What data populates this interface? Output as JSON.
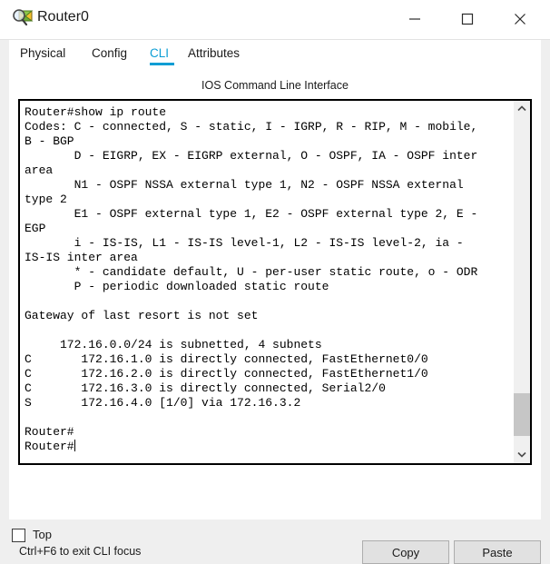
{
  "window": {
    "title": "Router0",
    "icon": "router-inspect-icon",
    "controls": {
      "minimize": "minimize-icon",
      "maximize": "maximize-icon",
      "close": "close-icon"
    }
  },
  "tabs": [
    {
      "label": "Physical",
      "active": false
    },
    {
      "label": "Config",
      "active": false
    },
    {
      "label": "CLI",
      "active": true
    },
    {
      "label": "Attributes",
      "active": false
    }
  ],
  "panel": {
    "heading": "IOS Command Line Interface",
    "terminal_text": "Router#show ip route\nCodes: C - connected, S - static, I - IGRP, R - RIP, M - mobile,\nB - BGP\n       D - EIGRP, EX - EIGRP external, O - OSPF, IA - OSPF inter\narea\n       N1 - OSPF NSSA external type 1, N2 - OSPF NSSA external\ntype 2\n       E1 - OSPF external type 1, E2 - OSPF external type 2, E -\nEGP\n       i - IS-IS, L1 - IS-IS level-1, L2 - IS-IS level-2, ia -\nIS-IS inter area\n       * - candidate default, U - per-user static route, o - ODR\n       P - periodic downloaded static route\n\nGateway of last resort is not set\n\n     172.16.0.0/24 is subnetted, 4 subnets\nC       172.16.1.0 is directly connected, FastEthernet0/0\nC       172.16.2.0 is directly connected, FastEthernet1/0\nC       172.16.3.0 is directly connected, Serial2/0\nS       172.16.4.0 [1/0] via 172.16.3.2\n\nRouter#\nRouter#"
  },
  "footer": {
    "hint": "Ctrl+F6 to exit CLI focus",
    "copy_label": "Copy",
    "paste_label": "Paste"
  },
  "top_option": {
    "label": "Top",
    "checked": false
  },
  "colors": {
    "accent": "#0b9dd4",
    "window_bg": "#efefef",
    "panel_bg": "#ffffff",
    "button_bg": "#e1e1e1",
    "scrollbar_thumb": "#c6c6c6"
  }
}
